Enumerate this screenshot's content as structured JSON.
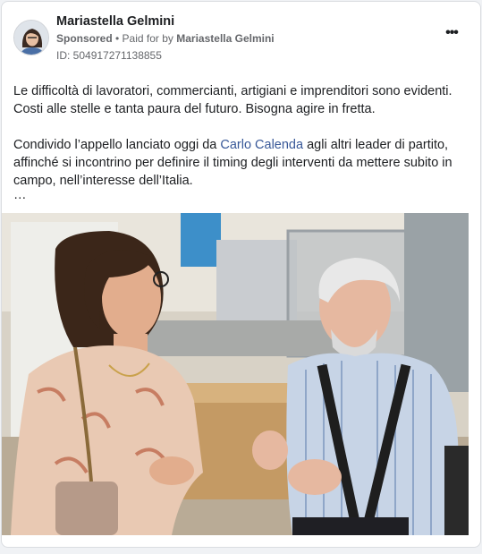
{
  "post": {
    "author_name": "Mariastella Gelmini",
    "sponsored_label": "Sponsored",
    "paid_for_prefix": " • Paid for by ",
    "paid_for_name": "Mariastella Gelmini",
    "ad_id": "ID: 504917271138855",
    "more_icon": "more-horizontal-icon",
    "paragraph_1": "Le difficoltà di lavoratori, commercianti, artigiani e imprenditori sono evidenti. Costi alle stelle e tanta paura del futuro. Bisogna agire in fretta.",
    "paragraph_2_before": "Condivido l’appello lanciato oggi da ",
    "paragraph_2_link": "Carlo Calenda",
    "paragraph_2_after": " agli altri leader di partito, affinché si incontrino per definire il timing degli interventi da mettere subito in campo, nell’interesse dell’Italia.",
    "see_more_ellipsis": "…"
  },
  "colors": {
    "link": "#385898",
    "secondary_text": "#65676b"
  }
}
